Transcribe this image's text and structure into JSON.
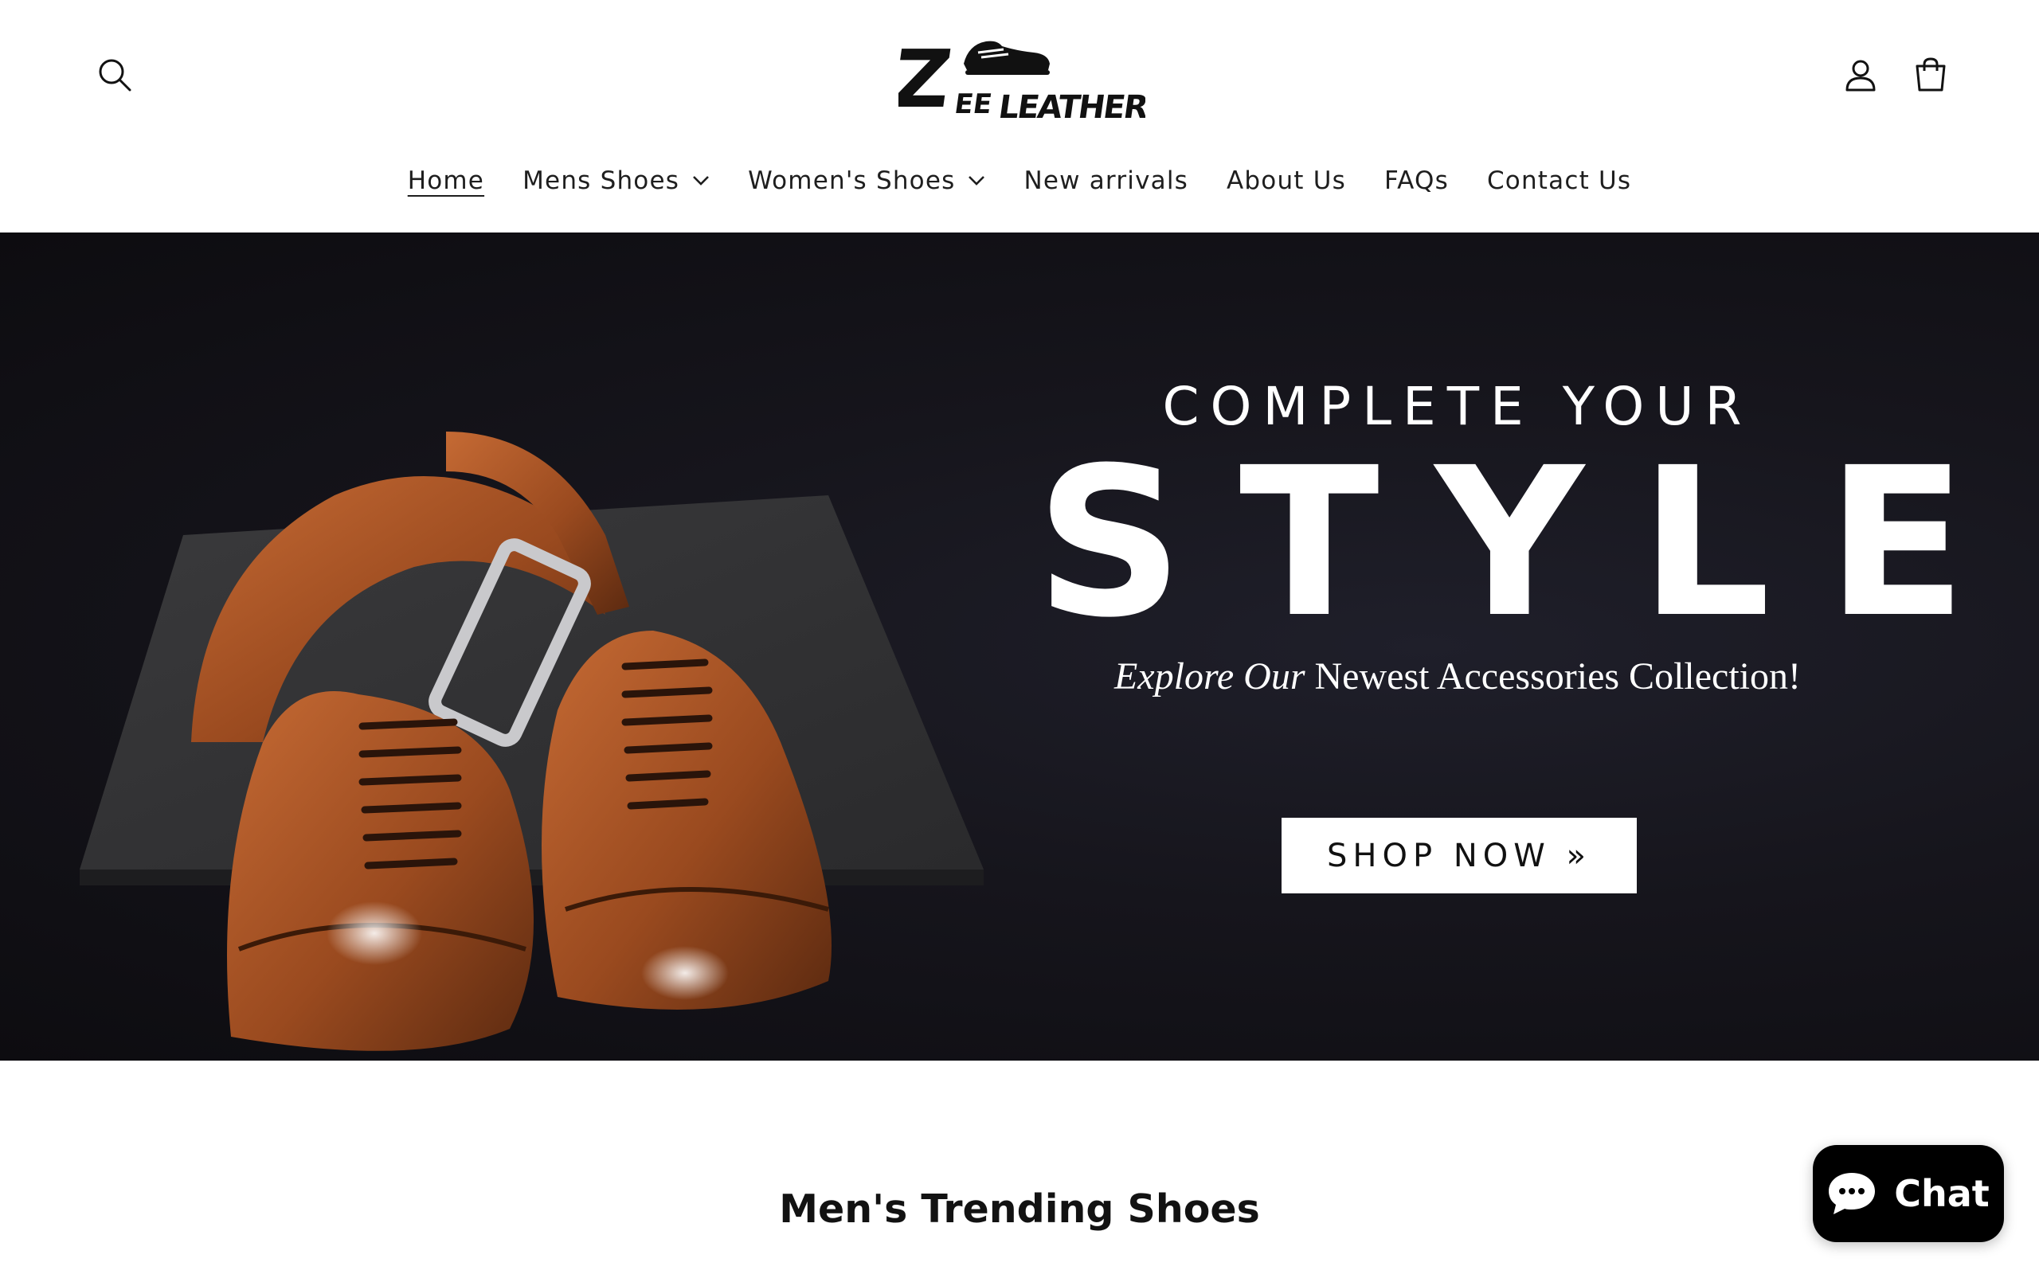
{
  "brand": {
    "logo_text_main": "Z",
    "logo_text_ee": "EE",
    "logo_text_leather": "LEATHER"
  },
  "header": {
    "icons": {
      "search": "search-icon",
      "account": "user-icon",
      "cart": "bag-icon"
    }
  },
  "nav": {
    "items": [
      {
        "label": "Home",
        "active": true,
        "dropdown": false
      },
      {
        "label": "Mens Shoes",
        "active": false,
        "dropdown": true
      },
      {
        "label": "Women's Shoes",
        "active": false,
        "dropdown": true
      },
      {
        "label": "New arrivals",
        "active": false,
        "dropdown": false
      },
      {
        "label": "About Us",
        "active": false,
        "dropdown": false
      },
      {
        "label": "FAQs",
        "active": false,
        "dropdown": false
      },
      {
        "label": "Contact Us",
        "active": false,
        "dropdown": false
      }
    ]
  },
  "hero": {
    "eyebrow": "COMPLETE YOUR",
    "headline": "STYLE",
    "sub_italic": "Explore Our",
    "sub_regular": " Newest Accessories Collection!",
    "cta_label": "SHOP NOW »"
  },
  "section": {
    "title": "Men's Trending Shoes"
  },
  "chat": {
    "label": "Chat"
  },
  "colors": {
    "accent": "#000000",
    "hero_bg": "#16151c",
    "leather": "#9a4a1f"
  }
}
